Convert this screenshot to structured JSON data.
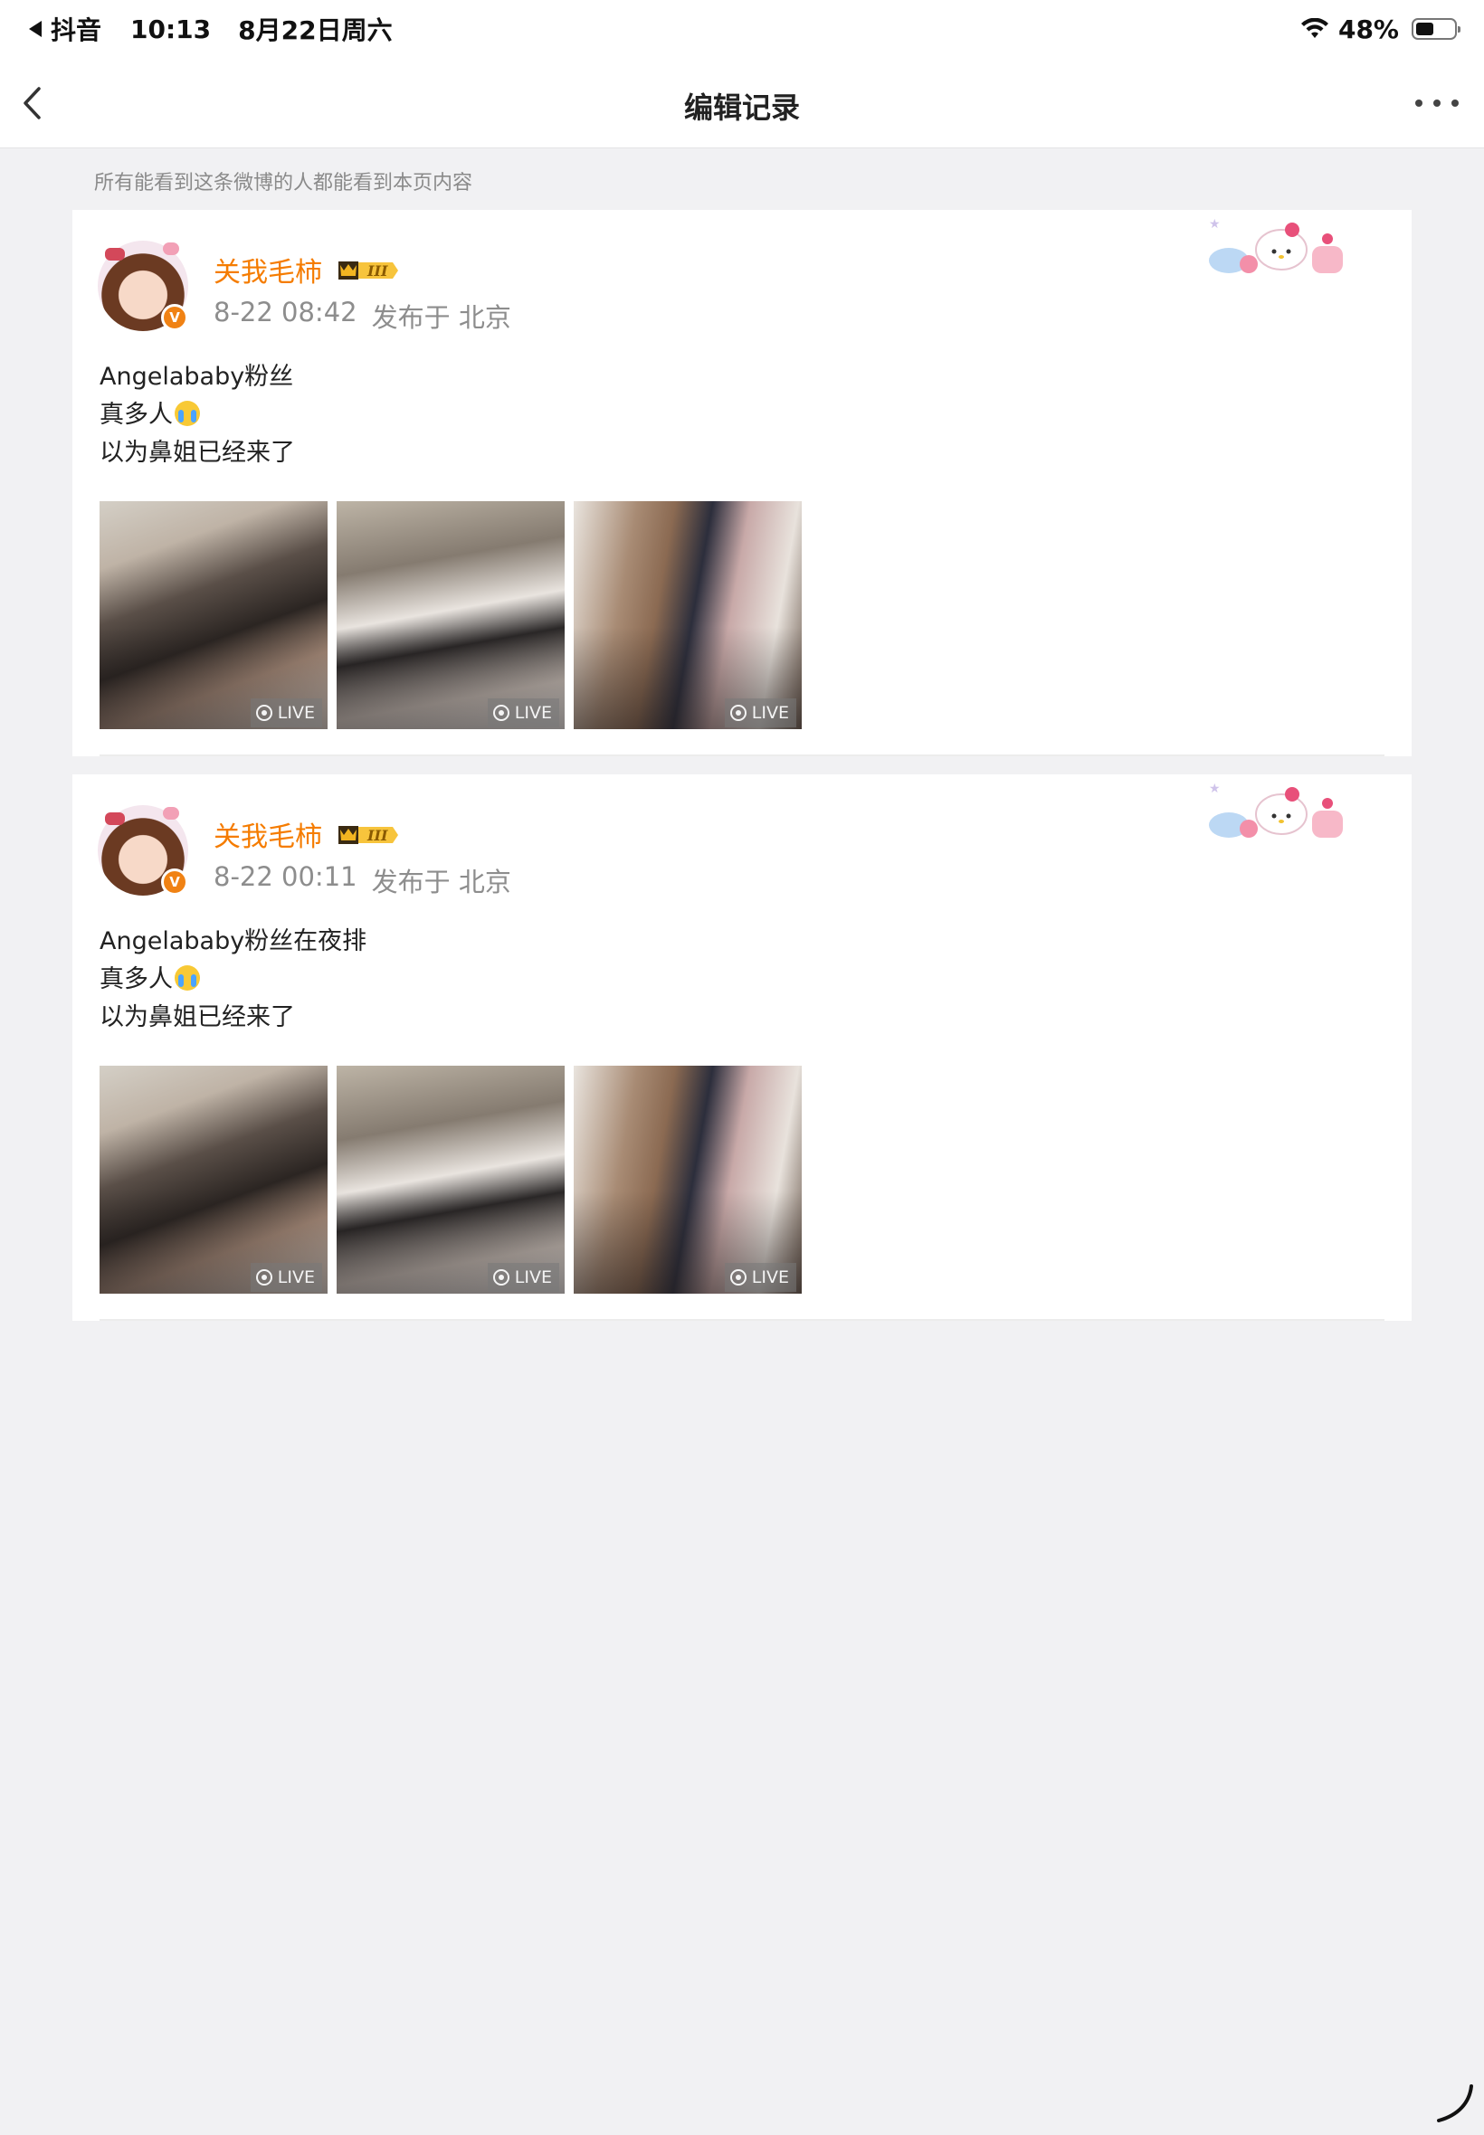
{
  "status_bar": {
    "app_name": "抖音",
    "time": "10:13",
    "date": "8月22日周六",
    "battery_text": "48%",
    "battery_level": 0.48,
    "icons": [
      "back-to-app-icon",
      "wifi-icon",
      "battery-icon"
    ]
  },
  "nav": {
    "title": "编辑记录",
    "back_icon": "chevron-left-icon",
    "more_icon": "more-dots-icon"
  },
  "notice": "所有能看到这条微博的人都能看到本页内容",
  "colors": {
    "username": "#f57c00",
    "page_bg": "#f1f1f3",
    "card_bg": "#ffffff",
    "meta_text": "#8d8d8d"
  },
  "posts": [
    {
      "username": "关我毛柿",
      "time": "8-22 08:42",
      "location": "发布于 北京",
      "lines": [
        "Angelababy粉丝",
        "真多人",
        "以为鼻姐已经来了"
      ],
      "photos": [
        {
          "badge": "LIVE"
        },
        {
          "badge": "LIVE"
        },
        {
          "badge": "LIVE"
        }
      ]
    },
    {
      "username": "关我毛柿",
      "time": "8-22 00:11",
      "location": "发布于 北京",
      "lines": [
        "Angelababy粉丝在夜排",
        "真多人",
        "以为鼻姐已经来了"
      ],
      "photos": [
        {
          "badge": "LIVE"
        },
        {
          "badge": "LIVE"
        },
        {
          "badge": "LIVE"
        }
      ]
    }
  ]
}
